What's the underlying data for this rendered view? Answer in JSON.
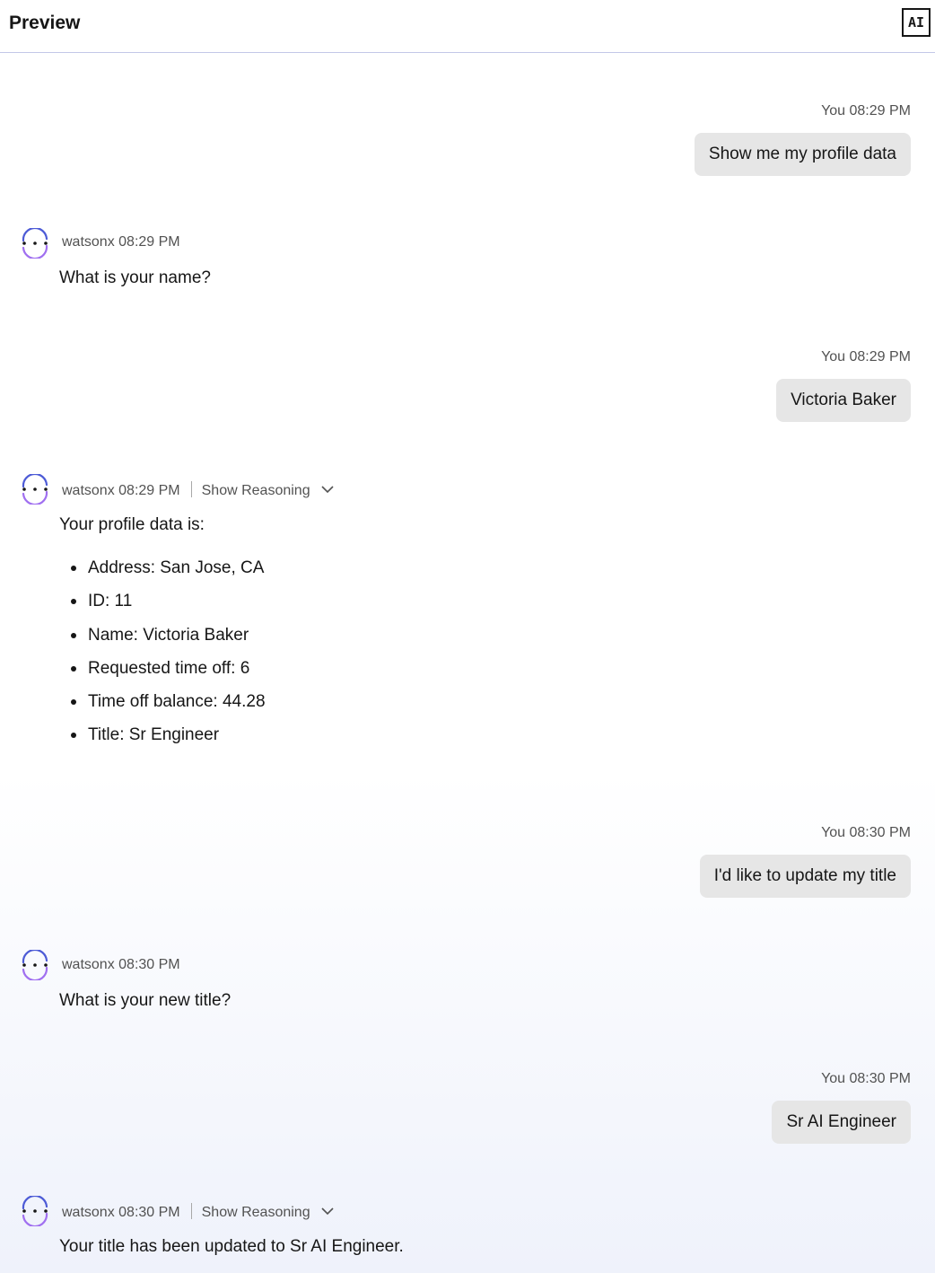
{
  "header": {
    "title": "Preview",
    "ai_badge": "AI"
  },
  "colors": {
    "bubble_bg": "#e6e6e6",
    "avatar_blue": "#4d5bd6",
    "avatar_purple": "#a06ff0",
    "text": "#161616",
    "meta": "#525252"
  },
  "icons": {
    "avatar": "watsonx-avatar-icon",
    "chevron": "chevron-down-icon"
  },
  "messages": [
    {
      "sender": "You",
      "time": "08:29 PM",
      "meta": "You 08:29 PM",
      "text": "Show me my profile data"
    },
    {
      "sender": "watsonx",
      "time": "08:29 PM",
      "meta": "watsonx 08:29 PM",
      "text": "What is your name?"
    },
    {
      "sender": "You",
      "time": "08:29 PM",
      "meta": "You 08:29 PM",
      "text": "Victoria Baker"
    },
    {
      "sender": "watsonx",
      "time": "08:29 PM",
      "meta": "watsonx 08:29 PM",
      "reasoning_label": "Show Reasoning",
      "text": "Your profile data is:",
      "items": [
        "Address: San Jose, CA",
        "ID: 11",
        "Name: Victoria Baker",
        "Requested time off: 6",
        "Time off balance: 44.28",
        "Title: Sr Engineer"
      ]
    },
    {
      "sender": "You",
      "time": "08:30 PM",
      "meta": "You 08:30 PM",
      "text": "I'd like to update my title"
    },
    {
      "sender": "watsonx",
      "time": "08:30 PM",
      "meta": "watsonx 08:30 PM",
      "text": "What is your new title?"
    },
    {
      "sender": "You",
      "time": "08:30 PM",
      "meta": "You 08:30 PM",
      "text": "Sr AI Engineer"
    },
    {
      "sender": "watsonx",
      "time": "08:30 PM",
      "meta": "watsonx 08:30 PM",
      "reasoning_label": "Show Reasoning",
      "text": "Your title has been updated to Sr AI Engineer."
    }
  ]
}
